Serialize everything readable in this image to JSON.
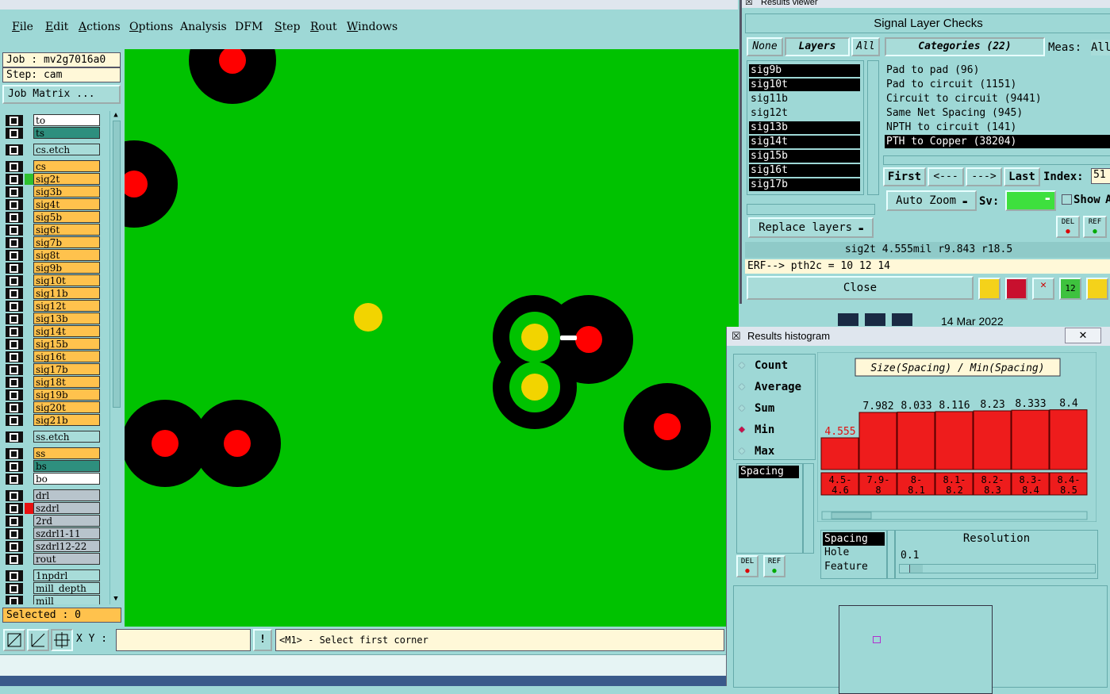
{
  "menu": [
    "File",
    "Edit",
    "Actions",
    "Options",
    "Analysis",
    "DFM",
    "Step",
    "Rout",
    "Windows"
  ],
  "left": {
    "job": "Job : mv2g7016a0",
    "step": "Step: cam",
    "job_matrix": "Job Matrix ...",
    "selected": "Selected : 0"
  },
  "layers": [
    {
      "name": "to",
      "bg": "#ffffff",
      "color": ""
    },
    {
      "name": "ts",
      "bg": "#2e8f7e",
      "color": ""
    },
    {
      "name": "cs.etch",
      "bg": "#a8dcd9",
      "color": "",
      "gap": true
    },
    {
      "name": "cs",
      "bg": "#ffc24d",
      "color": "",
      "gap": true
    },
    {
      "name": "sig2t",
      "bg": "#ffc24d",
      "color": "#2fc12f"
    },
    {
      "name": "sig3b",
      "bg": "#ffc24d",
      "color": ""
    },
    {
      "name": "sig4t",
      "bg": "#ffc24d",
      "color": ""
    },
    {
      "name": "sig5b",
      "bg": "#ffc24d",
      "color": ""
    },
    {
      "name": "sig6t",
      "bg": "#ffc24d",
      "color": ""
    },
    {
      "name": "sig7b",
      "bg": "#ffc24d",
      "color": ""
    },
    {
      "name": "sig8t",
      "bg": "#ffc24d",
      "color": ""
    },
    {
      "name": "sig9b",
      "bg": "#ffc24d",
      "color": ""
    },
    {
      "name": "sig10t",
      "bg": "#ffc24d",
      "color": ""
    },
    {
      "name": "sig11b",
      "bg": "#ffc24d",
      "color": ""
    },
    {
      "name": "sig12t",
      "bg": "#ffc24d",
      "color": ""
    },
    {
      "name": "sig13b",
      "bg": "#ffc24d",
      "color": ""
    },
    {
      "name": "sig14t",
      "bg": "#ffc24d",
      "color": ""
    },
    {
      "name": "sig15b",
      "bg": "#ffc24d",
      "color": ""
    },
    {
      "name": "sig16t",
      "bg": "#ffc24d",
      "color": ""
    },
    {
      "name": "sig17b",
      "bg": "#ffc24d",
      "color": ""
    },
    {
      "name": "sig18t",
      "bg": "#ffc24d",
      "color": ""
    },
    {
      "name": "sig19b",
      "bg": "#ffc24d",
      "color": ""
    },
    {
      "name": "sig20t",
      "bg": "#ffc24d",
      "color": ""
    },
    {
      "name": "sig21b",
      "bg": "#ffc24d",
      "color": ""
    },
    {
      "name": "ss.etch",
      "bg": "#a8dcd9",
      "color": "",
      "gap": true
    },
    {
      "name": "ss",
      "bg": "#ffc24d",
      "color": "",
      "gap": true
    },
    {
      "name": "bs",
      "bg": "#2e8f7e",
      "color": ""
    },
    {
      "name": "bo",
      "bg": "#ffffff",
      "color": ""
    },
    {
      "name": "drl",
      "bg": "#b8c4cc",
      "color": "",
      "gap": true
    },
    {
      "name": "szdrl",
      "bg": "#b8c4cc",
      "color": "#e81010"
    },
    {
      "name": "2rd",
      "bg": "#b8c4cc",
      "color": ""
    },
    {
      "name": "szdrl1-11",
      "bg": "#b8c4cc",
      "color": ""
    },
    {
      "name": "szdrl12-22",
      "bg": "#b8c4cc",
      "color": ""
    },
    {
      "name": "rout",
      "bg": "#b8c4cc",
      "color": ""
    },
    {
      "name": "1npdrl",
      "bg": "#a8dcd9",
      "color": "",
      "gap": true
    },
    {
      "name": "mill_depth",
      "bg": "#a8dcd9",
      "color": ""
    },
    {
      "name": "mill",
      "bg": "#a8dcd9",
      "color": ""
    }
  ],
  "bottom": {
    "xy_label": "X Y :",
    "xy_value": "",
    "prompt": "<M1> - Select first corner",
    "bang": "!"
  },
  "results_viewer": {
    "window_title": "Results viewer",
    "header": "Signal Layer Checks",
    "none_btn": "None",
    "layers_btn": "Layers",
    "all_btn": "All",
    "categories_btn": "Categories (22)",
    "meas_label": "Meas:",
    "meas_value": "All",
    "layer_items": [
      {
        "name": "sig9b",
        "sel": true
      },
      {
        "name": "sig10t",
        "sel": true
      },
      {
        "name": "sig11b",
        "sel": false
      },
      {
        "name": "sig12t",
        "sel": false
      },
      {
        "name": "sig13b",
        "sel": true
      },
      {
        "name": "sig14t",
        "sel": true
      },
      {
        "name": "sig15b",
        "sel": true
      },
      {
        "name": "sig16t",
        "sel": true
      },
      {
        "name": "sig17b",
        "sel": true
      }
    ],
    "categories": [
      {
        "name": "Pad to pad (96)",
        "sel": false
      },
      {
        "name": "Pad to circuit (1151)",
        "sel": false
      },
      {
        "name": "Circuit to circuit (9441)",
        "sel": false
      },
      {
        "name": "Same Net Spacing (945)",
        "sel": false
      },
      {
        "name": "NPTH to circuit (141)",
        "sel": false
      },
      {
        "name": "PTH to Copper (38204)",
        "sel": true
      }
    ],
    "first_btn": "First",
    "prev_btn": "<---",
    "next_btn": "--->",
    "last_btn": "Last",
    "index_label": "Index:",
    "index_value": "51",
    "auto_zoom": "Auto Zoom",
    "sv_label": "Sv:",
    "show_label": "Show",
    "show_value": "A",
    "replace_layers": "Replace layers",
    "del": "DEL",
    "ref": "REF",
    "measurement": "sig2t 4.555mil  r9.843  r18.5",
    "erf": "ERF--> pth2c = 10 12 14",
    "close": "Close",
    "toolbar_icon5": "12"
  },
  "background_panel": {
    "date": "14 Mar 2022"
  },
  "histogram": {
    "window_title": "Results histogram",
    "close_glyph": "✕",
    "modes": [
      {
        "name": "Count",
        "sel": false
      },
      {
        "name": "Average",
        "sel": false
      },
      {
        "name": "Sum",
        "sel": false
      },
      {
        "name": "Min",
        "sel": true
      },
      {
        "name": "Max",
        "sel": false
      }
    ],
    "list_label": "Spacing",
    "del": "DEL",
    "ref": "REF",
    "chart_title": "Size(Spacing) / Min(Spacing)",
    "options": [
      "Spacing",
      "Hole",
      "Feature"
    ],
    "resolution_label": "Resolution",
    "resolution_value": "0.1"
  },
  "chart_data": {
    "type": "bar",
    "title": "Size(Spacing) / Min(Spacing)",
    "categories": [
      "4.5-4.6",
      "7.9-8",
      "8-8.1",
      "8.1-8.2",
      "8.2-8.3",
      "8.3-8.4",
      "8.4-8.5"
    ],
    "values": [
      4.555,
      7.982,
      8.033,
      8.116,
      8.23,
      8.333,
      8.4
    ],
    "labels": [
      "4.555",
      "7.982",
      "8.033",
      "8.116",
      "8.23",
      "8.333",
      "8.4"
    ],
    "cat_lines": [
      [
        "4.5-",
        "4.6"
      ],
      [
        "7.9-",
        "8"
      ],
      [
        "8-",
        "8.1"
      ],
      [
        "8.1-",
        "8.2"
      ],
      [
        "8.2-",
        "8.3"
      ],
      [
        "8.3-",
        "8.4"
      ],
      [
        "8.4-",
        "8.5"
      ]
    ],
    "highlight_index": 0,
    "ylim": [
      0,
      9.0
    ]
  },
  "colors": {
    "canvas": "#00c200",
    "pad_red": "#ff0000",
    "pad_yellow": "#f2d400",
    "bar_red": "#ee1c1c",
    "panel_teal": "#9ed8d6"
  }
}
